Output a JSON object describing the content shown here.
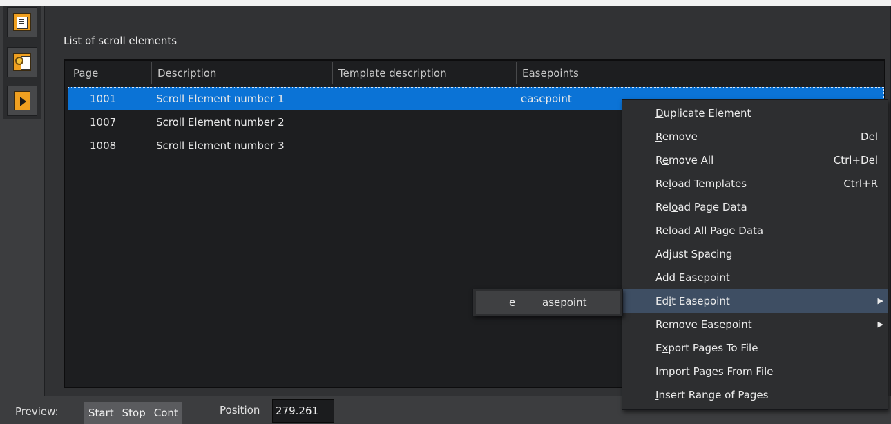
{
  "panel": {
    "title": "List of scroll elements"
  },
  "table": {
    "columns": [
      "Page",
      "Description",
      "Template description",
      "Easepoints",
      ""
    ],
    "rows": [
      {
        "page": "1001",
        "description": "Scroll Element number 1",
        "template": "",
        "easepoints": "easepoint"
      },
      {
        "page": "1007",
        "description": "Scroll Element number 2",
        "template": "",
        "easepoints": ""
      },
      {
        "page": "1008",
        "description": "Scroll Element number 3",
        "template": "",
        "easepoints": ""
      }
    ]
  },
  "context_menu": {
    "items": [
      {
        "pre": "",
        "u": "D",
        "post": "uplicate Element",
        "shortcut": ""
      },
      {
        "pre": "",
        "u": "R",
        "post": "emove",
        "shortcut": "Del"
      },
      {
        "pre": "R",
        "u": "e",
        "post": "move All",
        "shortcut": "Ctrl+Del"
      },
      {
        "pre": "Re",
        "u": "l",
        "post": "oad Templates",
        "shortcut": "Ctrl+R"
      },
      {
        "pre": "Rel",
        "u": "o",
        "post": "ad Page Data",
        "shortcut": ""
      },
      {
        "pre": "Relo",
        "u": "a",
        "post": "d All Page Data",
        "shortcut": ""
      },
      {
        "pre": "Ad",
        "u": "j",
        "post": "ust Spacing",
        "shortcut": ""
      },
      {
        "pre": "Add Ea",
        "u": "s",
        "post": "epoint",
        "shortcut": ""
      },
      {
        "pre": "Ed",
        "u": "i",
        "post": "t Easepoint",
        "shortcut": ""
      },
      {
        "pre": "Re",
        "u": "m",
        "post": "ove Easepoint",
        "shortcut": ""
      },
      {
        "pre": "E",
        "u": "x",
        "post": "port Pages To File",
        "shortcut": ""
      },
      {
        "pre": "Im",
        "u": "p",
        "post": "ort Pages From File",
        "shortcut": ""
      },
      {
        "pre": "",
        "u": "I",
        "post": "nsert Range of Pages",
        "shortcut": ""
      }
    ]
  },
  "submenu": {
    "u": "e",
    "post": "asepoint"
  },
  "bottom": {
    "preview_label": "Preview:",
    "start": "Start",
    "stop": "Stop",
    "cont": "Cont",
    "position_label": "Position",
    "position_value": "279.261"
  },
  "toolbar": {
    "icons": [
      "pages-icon",
      "settings-icon",
      "play-icon"
    ],
    "accent": "#f0a020"
  },
  "colors": {
    "selection": "#0b73d6",
    "menu_bg": "#2d2e30",
    "list_bg": "#1d1e20"
  }
}
